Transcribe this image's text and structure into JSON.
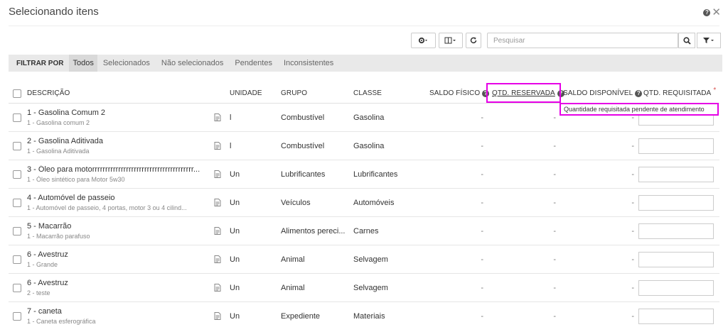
{
  "title": "Selecionando itens",
  "search": {
    "placeholder": "Pesquisar"
  },
  "filter": {
    "label": "FILTRAR POR",
    "tabs": [
      "Todos",
      "Selecionados",
      "Não selecionados",
      "Pendentes",
      "Inconsistentes"
    ],
    "active": "Todos"
  },
  "columns": {
    "descricao": "DESCRIÇÃO",
    "unidade": "UNIDADE",
    "grupo": "GRUPO",
    "classe": "CLASSE",
    "saldo_fisico": "SALDO FÍSICO",
    "qtd_reservada": "QTD. RESERVADA",
    "saldo_disponivel": "SALDO DISPONÍVEL",
    "qtd_requisitada": "QTD. REQUISITADA",
    "required_mark": "*"
  },
  "tooltip": "Quantidade requisitada pendente de atendimento",
  "rows": [
    {
      "title": "1 - Gasolina Comum 2",
      "sub": "1 - Gasolina comum 2",
      "unidade": "l",
      "grupo": "Combustível",
      "classe": "Gasolina",
      "saldo_fisico": "-",
      "qtd_reservada": "-",
      "saldo_disponivel": "-"
    },
    {
      "title": "2 - Gasolina Aditivada",
      "sub": "1 - Gasolina Aditivada",
      "unidade": "l",
      "grupo": "Combustível",
      "classe": "Gasolina",
      "saldo_fisico": "-",
      "qtd_reservada": "-",
      "saldo_disponivel": "-"
    },
    {
      "title": "3 - Óleo para motorrrrrrrrrrrrrrrrrrrrrrrrrrrrrrrrrrrrrrr...",
      "sub": "1 - Óleo sintético para Motor 5w30",
      "unidade": "Un",
      "grupo": "Lubrificantes",
      "classe": "Lubrificantes",
      "saldo_fisico": "-",
      "qtd_reservada": "-",
      "saldo_disponivel": "-"
    },
    {
      "title": "4 - Automóvel de passeio",
      "sub": "1 - Automóvel de passeio, 4 portas, motor 3 ou 4 cilind...",
      "unidade": "Un",
      "grupo": "Veículos",
      "classe": "Automóveis",
      "saldo_fisico": "-",
      "qtd_reservada": "-",
      "saldo_disponivel": "-"
    },
    {
      "title": "5 - Macarrão",
      "sub": "1 - Macarrão parafuso",
      "unidade": "Un",
      "grupo": "Alimentos pereci...",
      "classe": "Carnes",
      "saldo_fisico": "-",
      "qtd_reservada": "-",
      "saldo_disponivel": "-"
    },
    {
      "title": "6 - Avestruz",
      "sub": "1 - Grande",
      "unidade": "Un",
      "grupo": "Animal",
      "classe": "Selvagem",
      "saldo_fisico": "-",
      "qtd_reservada": "-",
      "saldo_disponivel": "-"
    },
    {
      "title": "6 - Avestruz",
      "sub": "2 - teste",
      "unidade": "Un",
      "grupo": "Animal",
      "classe": "Selvagem",
      "saldo_fisico": "-",
      "qtd_reservada": "-",
      "saldo_disponivel": "-"
    },
    {
      "title": "7 - caneta",
      "sub": "1 - Caneta esferográfica",
      "unidade": "Un",
      "grupo": "Expediente",
      "classe": "Materiais",
      "saldo_fisico": "-",
      "qtd_reservada": "-",
      "saldo_disponivel": "-"
    }
  ],
  "icons": {
    "help": "help-icon",
    "close": "close-icon",
    "gear": "gear-icon",
    "columns": "columns-icon",
    "refresh": "refresh-icon",
    "search": "search-icon",
    "filter": "filter-icon",
    "detail": "document-icon"
  },
  "colors": {
    "highlight": "#e600e6",
    "required": "#d9534f"
  }
}
